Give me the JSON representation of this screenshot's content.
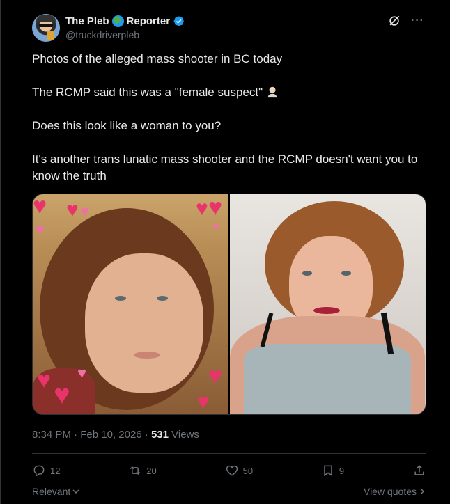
{
  "author": {
    "display_name": "The Pleb",
    "display_name_suffix": "Reporter",
    "handle": "@truckdriverpleb"
  },
  "icons": {
    "globe": "globe-emoji-icon",
    "verified": "verified-badge-icon",
    "grok": "grok-icon",
    "more": "more-icon"
  },
  "tweet": {
    "line1": "Photos of the alleged mass shooter in BC today",
    "line2": "The RCMP said this was a \"female suspect\"",
    "line2_emoji": "person-facepalming-emoji",
    "line3": "Does this look like a woman to you?",
    "line4": "It's another trans lunatic mass shooter and the RCMP doesn't want you to know the truth"
  },
  "meta": {
    "time": "8:34 PM",
    "separator": "·",
    "date": "Feb 10, 2026",
    "views_count": "531",
    "views_label": "Views"
  },
  "actions": {
    "replies": "12",
    "reposts": "20",
    "likes": "50",
    "bookmarks": "9"
  },
  "footer": {
    "sort_label": "Relevant",
    "view_quotes": "View quotes"
  },
  "colors": {
    "background": "#000000",
    "text": "#e7e9ea",
    "muted": "#71767b",
    "border": "#2f3336",
    "verified": "#1d9bf0"
  }
}
